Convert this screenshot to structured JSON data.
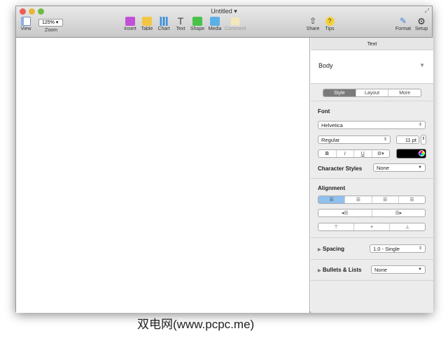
{
  "window": {
    "title": "Untitled"
  },
  "toolbar": {
    "view": "View",
    "zoom_value": "125%",
    "zoom": "Zoom",
    "insert": "Insert",
    "table": "Table",
    "chart": "Chart",
    "text": "Text",
    "shape": "Shape",
    "media": "Media",
    "comment": "Comment",
    "share": "Share",
    "tips": "Tips",
    "format": "Format",
    "setup": "Setup"
  },
  "sidebar": {
    "header": "Text",
    "paragraph_style": "Body",
    "tabs": [
      "Style",
      "Layout",
      "More"
    ],
    "font_label": "Font",
    "font_family": "Helvetica",
    "font_style": "Regular",
    "font_size": "11 pt",
    "bold": "B",
    "italic": "I",
    "underline": "U",
    "text_color": "#000000",
    "char_styles_label": "Character Styles",
    "char_styles_value": "None",
    "alignment_label": "Alignment",
    "spacing_label": "Spacing",
    "spacing_value": "1.0 - Single",
    "bullets_label": "Bullets & Lists",
    "bullets_value": "None"
  },
  "watermark": "双电网(www.pcpc.me)"
}
